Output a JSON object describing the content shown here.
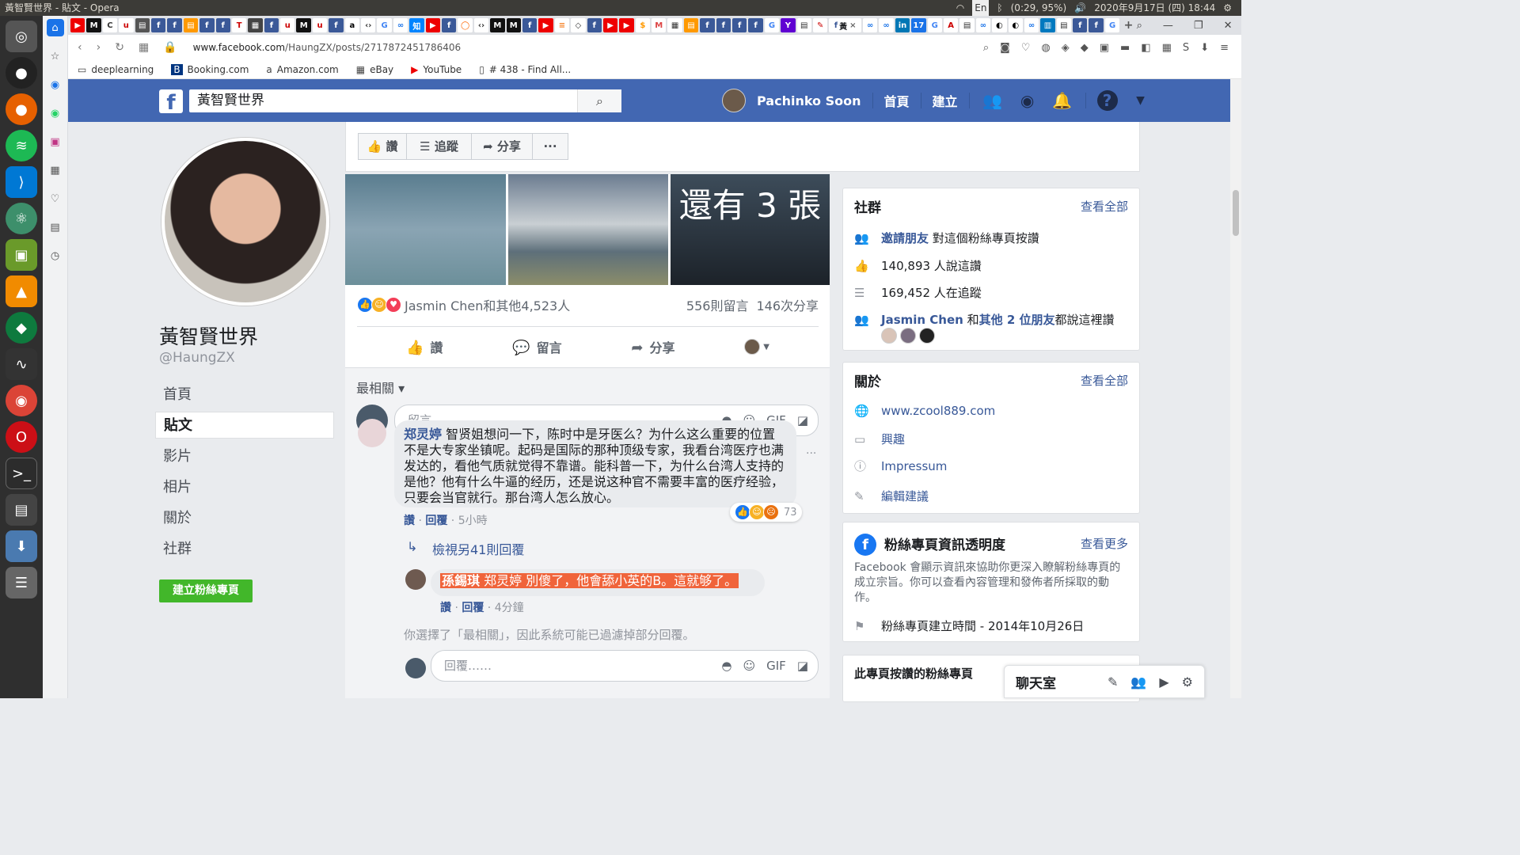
{
  "system": {
    "window_title": "黃智賢世界 - 貼文 - Opera",
    "battery": "(0:29, 95%)",
    "datetime": "2020年9月17日 (四) 18:44",
    "lang": "En"
  },
  "browser": {
    "url_host": "www.facebook.com",
    "url_path": "/HaungZX/posts/2717872451786406",
    "bookmarks": [
      "deeplearning",
      "Booking.com",
      "Amazon.com",
      "eBay",
      "YouTube",
      "# 438 - Find All..."
    ],
    "active_tab_label": "黃"
  },
  "fb": {
    "search_value": "黃智賢世界",
    "user_name": "Pachinko Soon",
    "nav_home": "首頁",
    "nav_create": "建立"
  },
  "page": {
    "name": "黃智賢世界",
    "handle": "@HaungZX",
    "nav": [
      "首頁",
      "貼文",
      "影片",
      "相片",
      "關於",
      "社群"
    ],
    "create_button": "建立粉絲專頁"
  },
  "actions": {
    "like": "讚",
    "follow": "追蹤",
    "share": "分享",
    "more": "···"
  },
  "post": {
    "photo_overlay": "還有 3 張",
    "reactions_text": "Jasmin Chen和其他4,523人",
    "comments_count": "556則留言",
    "shares_count": "146次分享",
    "btn_like": "讚",
    "btn_comment": "留言",
    "btn_share": "分享",
    "sort_label": "最相關 ▾",
    "comment_placeholder": "留言……",
    "comment1_author": "郑灵婷",
    "comment1_text": "智贤姐想问一下，陈时中是牙医么？为什么这么重要的位置不是大专家坐镇呢。起码是国际的那种顶级专家，我看台湾医疗也满发达的，看他气质就觉得不靠谱。能科普一下，为什么台湾人支持的是他？他有什么牛逼的经历，还是说这种官不需要丰富的医疗经验，只要会当官就行。那台湾人怎么放心。",
    "comment1_like": "讚",
    "comment1_reply": "回覆",
    "comment1_time": "5小時",
    "comment1_reactions": "73",
    "view_more_replies": "檢視另41則回覆",
    "reply1_author": "孫錫琪",
    "reply1_text": "郑灵婷 別傻了，他會舔小英的B。這就够了。",
    "reply1_like": "讚",
    "reply1_reply": "回覆",
    "reply1_time": "4分鐘",
    "filter_note": "你選擇了「最相關」，因此系統可能已過濾掉部分回覆。",
    "reply_placeholder": "回覆……"
  },
  "community": {
    "title": "社群",
    "see_all": "查看全部",
    "invite_link": "邀請朋友",
    "invite_rest": "對這個粉絲專頁按讚",
    "likes": "140,893 人說這讚",
    "follows": "169,452 人在追蹤",
    "friends_name": "Jasmin Chen",
    "friends_and": "和",
    "friends_others": "其他 2 位朋友",
    "friends_rest": "都說這裡讚"
  },
  "about": {
    "title": "關於",
    "see_all": "查看全部",
    "website": "www.zcool889.com",
    "category": "興趣",
    "impressum": "Impressum",
    "edit": "編輯建議"
  },
  "transparency": {
    "title": "粉絲專頁資訊透明度",
    "see_more": "查看更多",
    "desc": "Facebook 會顯示資訊來協助你更深入瞭解粉絲專頁的成立宗旨。你可以查看內容管理和發佈者所採取的動作。",
    "created": "粉絲專頁建立時間 - 2014年10月26日"
  },
  "liked_pages": {
    "title": "此專頁按讚的粉絲專頁"
  },
  "chat": {
    "label": "聊天室"
  }
}
